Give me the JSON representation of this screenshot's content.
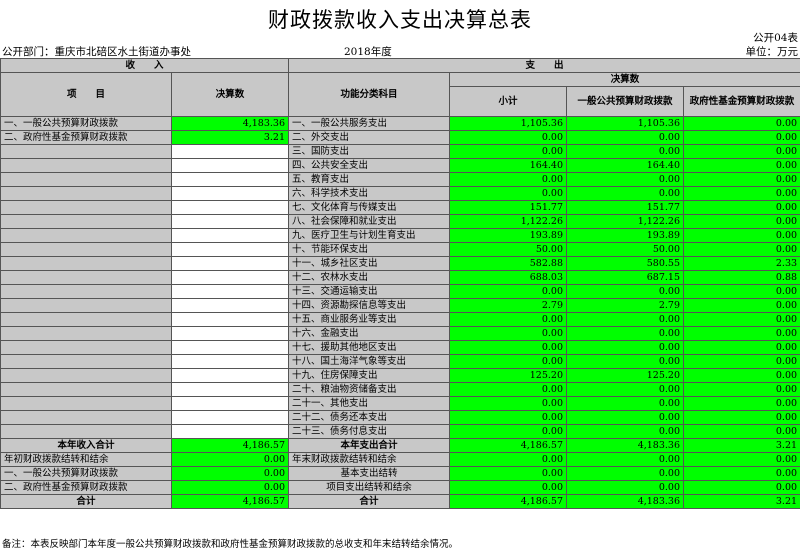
{
  "title": "财政拨款收入支出决算总表",
  "form_code": "公开04表",
  "dept_label": "公开部门：重庆市北碚区水土街道办事处",
  "year": "2018年度",
  "unit": "单位：万元",
  "headers": {
    "income": "收　　入",
    "expense": "支　　出",
    "item": "项　　目",
    "final_amount": "决算数",
    "func_class": "功能分类科目",
    "final_amount_group": "决算数",
    "subtotal": "小计",
    "general_budget": "一般公共预算财政拨款",
    "gov_fund": "政府性基金预算财政拨款"
  },
  "income_items": [
    {
      "label": "一、一般公共预算财政拨款",
      "value": "4,183.36"
    },
    {
      "label": "二、政府性基金预算财政拨款",
      "value": "3.21"
    }
  ],
  "expense_rows": [
    {
      "label": "一、一般公共服务支出",
      "subtotal": "1,105.36",
      "general": "1,105.36",
      "fund": "0.00"
    },
    {
      "label": "二、外交支出",
      "subtotal": "0.00",
      "general": "0.00",
      "fund": "0.00"
    },
    {
      "label": "三、国防支出",
      "subtotal": "0.00",
      "general": "0.00",
      "fund": "0.00"
    },
    {
      "label": "四、公共安全支出",
      "subtotal": "164.40",
      "general": "164.40",
      "fund": "0.00"
    },
    {
      "label": "五、教育支出",
      "subtotal": "0.00",
      "general": "0.00",
      "fund": "0.00"
    },
    {
      "label": "六、科学技术支出",
      "subtotal": "0.00",
      "general": "0.00",
      "fund": "0.00"
    },
    {
      "label": "七、文化体育与传媒支出",
      "subtotal": "151.77",
      "general": "151.77",
      "fund": "0.00"
    },
    {
      "label": "八、社会保障和就业支出",
      "subtotal": "1,122.26",
      "general": "1,122.26",
      "fund": "0.00"
    },
    {
      "label": "九、医疗卫生与计划生育支出",
      "subtotal": "193.89",
      "general": "193.89",
      "fund": "0.00"
    },
    {
      "label": "十、节能环保支出",
      "subtotal": "50.00",
      "general": "50.00",
      "fund": "0.00"
    },
    {
      "label": "十一、城乡社区支出",
      "subtotal": "582.88",
      "general": "580.55",
      "fund": "2.33"
    },
    {
      "label": "十二、农林水支出",
      "subtotal": "688.03",
      "general": "687.15",
      "fund": "0.88"
    },
    {
      "label": "十三、交通运输支出",
      "subtotal": "0.00",
      "general": "0.00",
      "fund": "0.00"
    },
    {
      "label": "十四、资源勘探信息等支出",
      "subtotal": "2.79",
      "general": "2.79",
      "fund": "0.00"
    },
    {
      "label": "十五、商业服务业等支出",
      "subtotal": "0.00",
      "general": "0.00",
      "fund": "0.00"
    },
    {
      "label": "十六、金融支出",
      "subtotal": "0.00",
      "general": "0.00",
      "fund": "0.00"
    },
    {
      "label": "十七、援助其他地区支出",
      "subtotal": "0.00",
      "general": "0.00",
      "fund": "0.00"
    },
    {
      "label": "十八、国土海洋气象等支出",
      "subtotal": "0.00",
      "general": "0.00",
      "fund": "0.00"
    },
    {
      "label": "十九、住房保障支出",
      "subtotal": "125.20",
      "general": "125.20",
      "fund": "0.00"
    },
    {
      "label": "二十、粮油物资储备支出",
      "subtotal": "0.00",
      "general": "0.00",
      "fund": "0.00"
    },
    {
      "label": "二十一、其他支出",
      "subtotal": "0.00",
      "general": "0.00",
      "fund": "0.00"
    },
    {
      "label": "二十二、债务还本支出",
      "subtotal": "0.00",
      "general": "0.00",
      "fund": "0.00"
    },
    {
      "label": "二十三、债务付息支出",
      "subtotal": "0.00",
      "general": "0.00",
      "fund": "0.00"
    }
  ],
  "totals": {
    "income_total_label": "本年收入合计",
    "income_total_value": "4,186.57",
    "expense_total_label": "本年支出合计",
    "expense_total": {
      "subtotal": "4,186.57",
      "general": "4,183.36",
      "fund": "3.21"
    },
    "carry_in_label": "年初财政拨款结转和结余",
    "carry_in_value": "0.00",
    "carry_out_label": "年末财政拨款结转和结余",
    "carry_out": {
      "subtotal": "0.00",
      "general": "0.00",
      "fund": "0.00"
    },
    "ci_general_label": "一、一般公共预算财政拨款",
    "ci_general_value": "0.00",
    "basic_carry_label": "基本支出结转",
    "basic_carry": {
      "subtotal": "0.00",
      "general": "0.00",
      "fund": "0.00"
    },
    "ci_fund_label": "二、政府性基金预算财政拨款",
    "ci_fund_value": "0.00",
    "project_carry_label": "项目支出结转和结余",
    "project_carry": {
      "subtotal": "0.00",
      "general": "0.00",
      "fund": "0.00"
    },
    "grand_total_label_left": "合计",
    "grand_total_value_left": "4,186.57",
    "grand_total_label_right": "合计",
    "grand_total": {
      "subtotal": "4,186.57",
      "general": "4,183.36",
      "fund": "3.21"
    }
  },
  "note": "备注：本表反映部门本年度一般公共预算财政拨款和政府性基金预算财政拨款的总收支和年末结转结余情况。",
  "colors": {
    "green": "#00ff00",
    "gray": "#c8c8c8",
    "white": "#ffffff"
  }
}
